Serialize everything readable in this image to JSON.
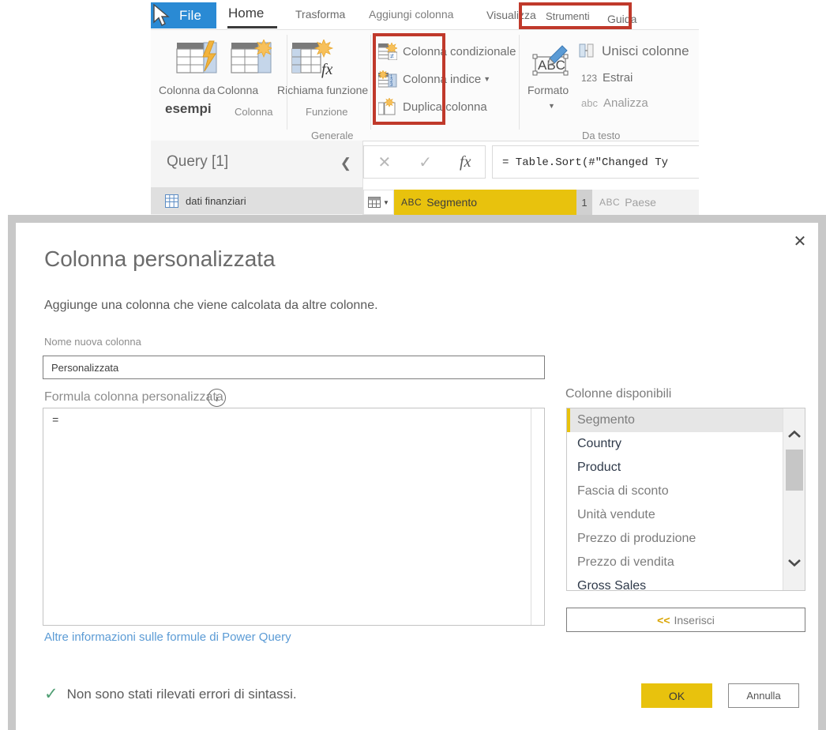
{
  "app": {
    "tabs": [
      {
        "id": "file",
        "label": "File"
      },
      {
        "id": "home",
        "label": "Home"
      },
      {
        "id": "trasforma",
        "label": "Trasforma"
      },
      {
        "id": "aggiungi",
        "label": "Aggiungi colonna"
      },
      {
        "id": "visualizza",
        "label": "Visualizza"
      },
      {
        "id": "strumenti",
        "label": "Strumenti"
      },
      {
        "id": "guida",
        "label": "Guida"
      }
    ],
    "ribbon": {
      "big_buttons": [
        {
          "label_line1": "Colonna da",
          "label_line2": "esempi"
        },
        {
          "label_line1": "Colonna",
          "label_line2": ""
        },
        {
          "label_line1": "Richiama funzione",
          "label_line2": ""
        }
      ],
      "small_buttons": [
        {
          "label": "Colonna condizionale"
        },
        {
          "label": "Colonna indice"
        },
        {
          "label": "Duplica colonna"
        },
        {
          "label": "Unisci colonne"
        },
        {
          "label": "Estrai",
          "prefix": "123"
        },
        {
          "label": "Analizza",
          "prefix": "abc"
        }
      ],
      "format_label": "Formato",
      "group_labels": [
        {
          "label": "Colonna"
        },
        {
          "label": "Funzione"
        },
        {
          "label": "Generale"
        },
        {
          "label": "Da testo"
        }
      ]
    },
    "query_pane": {
      "title": "Query [1]",
      "collapse_icon": "chevron-left",
      "items": [
        {
          "label": "dati finanziari"
        }
      ]
    },
    "formula_bar": {
      "cancel_icon": "✕",
      "accept_icon": "✓",
      "fx_icon": "fx",
      "value": "= Table.Sort(#\"Changed Ty"
    },
    "grid": {
      "columns": [
        {
          "type_prefix": "ABC",
          "name": "Segmento",
          "sort_badge": "1",
          "selected": true
        },
        {
          "type_prefix": "ABC",
          "name": "Paese",
          "sort_badge": "",
          "selected": false
        }
      ]
    }
  },
  "dialog": {
    "close_icon": "✕",
    "title": "Colonna personalizzata",
    "description": "Aggiunge una colonna che viene calcolata da altre colonne.",
    "name_label": "Nome nuova colonna",
    "name_value": "Personalizzata",
    "formula_label": "Formula colonna personalizzata",
    "info_icon_char": "i",
    "formula_value": "=",
    "more_info_link": "Altre informazioni sulle formule di Power Query",
    "available_columns_label": "Colonne disponibili",
    "available_columns": [
      {
        "label": "Segmento",
        "selected": true,
        "emphasis": false
      },
      {
        "label": "Country",
        "selected": false,
        "emphasis": true
      },
      {
        "label": "Product",
        "selected": false,
        "emphasis": true
      },
      {
        "label": "Fascia di sconto",
        "selected": false,
        "emphasis": false
      },
      {
        "label": "Unità vendute",
        "selected": false,
        "emphasis": false
      },
      {
        "label": "Prezzo di produzione",
        "selected": false,
        "emphasis": false
      },
      {
        "label": "Prezzo di vendita",
        "selected": false,
        "emphasis": false
      },
      {
        "label": "Gross Sales",
        "selected": false,
        "emphasis": true
      }
    ],
    "insert_button": "<<  Inserisci",
    "insert_chevrons": "<<",
    "insert_text": "Inserisci",
    "status_text": "Non sono stati rilevati errori di sintassi.",
    "status_icon": "✓",
    "ok_button": "OK",
    "cancel_button": "Annulla"
  },
  "colors": {
    "accent_yellow": "#e8c20d",
    "file_tab_blue": "#2a8ad4",
    "callout_red": "#c0392b",
    "link_blue": "#5b9bd5",
    "status_green": "#4f9e73",
    "teal_underline": "#1aa9a4"
  }
}
